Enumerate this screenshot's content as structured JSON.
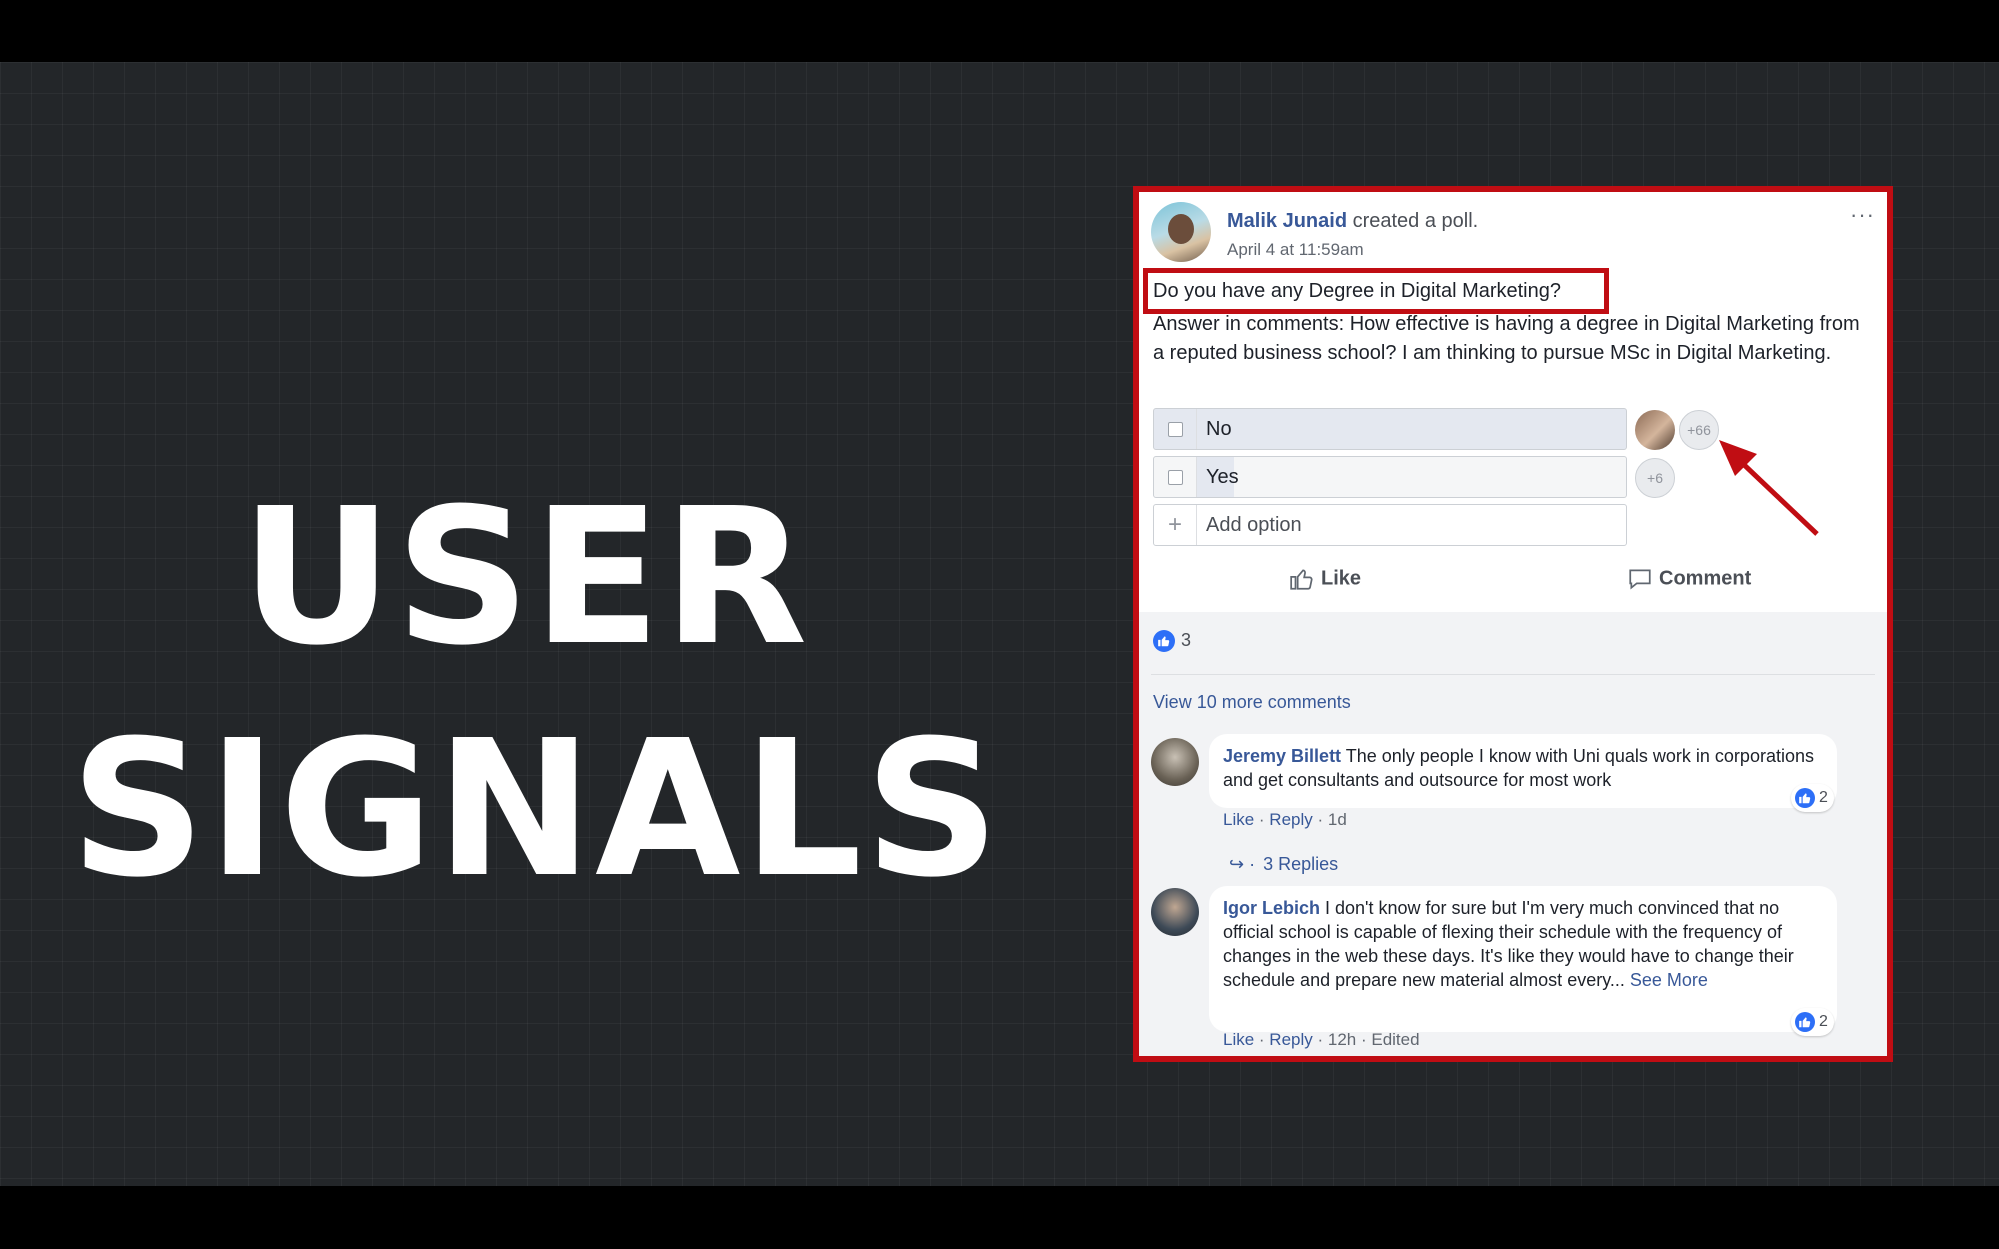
{
  "slide": {
    "headline_line1": "USER",
    "headline_line2": "SIGNALS"
  },
  "post": {
    "author_name": "Malik Junaid",
    "action_text": " created a poll.",
    "timestamp": "April 4 at 11:59am",
    "question": "Do you have any Degree in Digital Marketing?",
    "body": "Answer in comments: How effective is having a degree in Digital Marketing from a reputed business school? I am thinking to pursue MSc in Digital Marketing.",
    "more_icon": "···"
  },
  "poll": {
    "options": [
      {
        "label": "No",
        "extra_count": "+66"
      },
      {
        "label": "Yes",
        "extra_count": "+6"
      }
    ],
    "add_option_label": "Add option",
    "add_option_icon": "+"
  },
  "actions": {
    "like_label": "Like",
    "comment_label": "Comment"
  },
  "reactions": {
    "count": "3"
  },
  "comments": {
    "view_more_label": "View 10 more comments",
    "items": [
      {
        "author": "Jeremy Billett",
        "text": " The only people I know with Uni quals work in corporations and get consultants and outsource for most work",
        "like_link": "Like",
        "reply_link": "Reply",
        "age": "1d",
        "reaction_count": "2",
        "replies_label": "3 Replies"
      },
      {
        "author": "Igor Lebich",
        "text": " I don't know for sure but I'm very much convinced that no official school is capable of flexing their schedule with the frequency of changes in the web these days. It's like they would have to change their schedule and prepare new material almost every...",
        "see_more": " See More",
        "like_link": "Like",
        "reply_link": "Reply",
        "age": "12h",
        "edited": "Edited",
        "reaction_count": "2"
      }
    ]
  },
  "colors": {
    "highlight_red": "#c00d13",
    "facebook_blue": "#385898",
    "like_blue": "#2d6ff7",
    "slide_bg": "#232629"
  }
}
